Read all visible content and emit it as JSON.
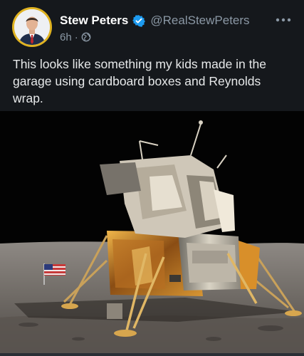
{
  "author": {
    "display_name": "Stew Peters",
    "handle": "@RealStewPeters",
    "verified": true,
    "verified_color": "#1d9bf0",
    "avatar_ring_color": "#e0b321"
  },
  "meta": {
    "timestamp": "6h",
    "separator": "·",
    "visibility_icon": "globe-icon"
  },
  "actions": {
    "more_icon": "more-options-icon"
  },
  "post": {
    "text": "This looks like something my kids made in the garage using cardboard boxes and Reynolds wrap."
  },
  "media": {
    "kind": "photo",
    "icon_names": [
      "lunar-module",
      "american-flag"
    ]
  },
  "theme": {
    "background": "#15181c",
    "text_primary": "#e7e9ea",
    "text_secondary": "#8b98a5"
  }
}
